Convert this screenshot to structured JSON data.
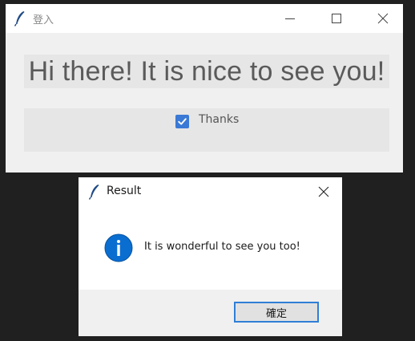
{
  "main_window": {
    "title": "登入",
    "greeting": "Hi there! It is nice to see you!",
    "checkbox": {
      "label": "Thanks",
      "checked": true
    }
  },
  "dialog": {
    "title": "Result",
    "message": "It is wonderful to see you too!",
    "ok_label": "確定",
    "icon": "info-icon"
  },
  "colors": {
    "checkbox_accent": "#3a79d5",
    "info_icon": "#0a6ed1",
    "focus_border": "#2f7fd6",
    "desktop_background": "#202020"
  }
}
